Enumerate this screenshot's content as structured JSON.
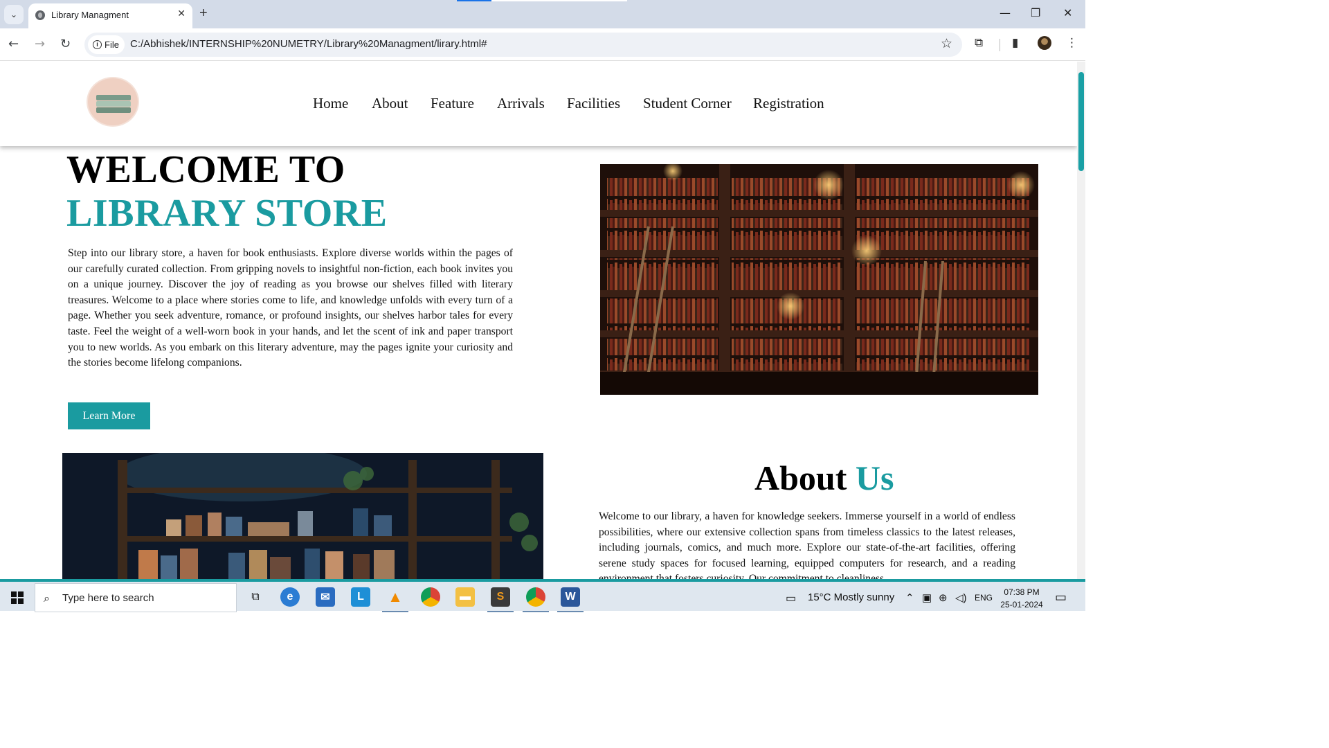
{
  "browser": {
    "tab_title": "Library Managment",
    "new_tab_icon": "+",
    "close_icon": "✕",
    "site_chip": "File",
    "url": "C:/Abhishek/INTERNSHIP%20NUMETRY/Library%20Managment/lirary.html#",
    "window_controls": [
      "—",
      "❐",
      "✕"
    ]
  },
  "header": {
    "nav": [
      "Home",
      "About",
      "Feature",
      "Arrivals",
      "Facilities",
      "Student Corner",
      "Registration"
    ]
  },
  "hero": {
    "title_line1": "WELCOME TO",
    "title_line2": "LIBRARY STORE",
    "intro": "Step into our library store, a haven for book enthusiasts. Explore diverse worlds within the pages of our carefully curated collection. From gripping novels to insightful non-fiction, each book invites you on a unique journey. Discover the joy of reading as you browse our shelves filled with literary treasures. Welcome to a place where stories come to life, and knowledge unfolds with every turn of a page. Whether you seek adventure, romance, or profound insights, our shelves harbor tales for every taste. Feel the weight of a well-worn book in your hands, and let the scent of ink and paper transport you to new worlds. As you embark on this literary adventure, may the pages ignite your curiosity and the stories become lifelong companions.",
    "button": "Learn More"
  },
  "about": {
    "heading_1": "About",
    "heading_2": "Us",
    "text": "Welcome to our library, a haven for knowledge seekers. Immerse yourself in a world of endless possibilities, where our extensive collection spans from timeless classics to the latest releases, including journals, comics, and much more. Explore our state-of-the-art facilities, offering serene study spaces for focused learning, equipped computers for research, and a reading environment that fosters curiosity. Our commitment to cleanliness"
  },
  "taskbar": {
    "search_placeholder": "Type here to search",
    "weather": "15°C  Mostly sunny",
    "language": "ENG",
    "time": "07:38 PM",
    "date": "25-01-2024"
  },
  "colors": {
    "accent": "#1a9ba0"
  }
}
